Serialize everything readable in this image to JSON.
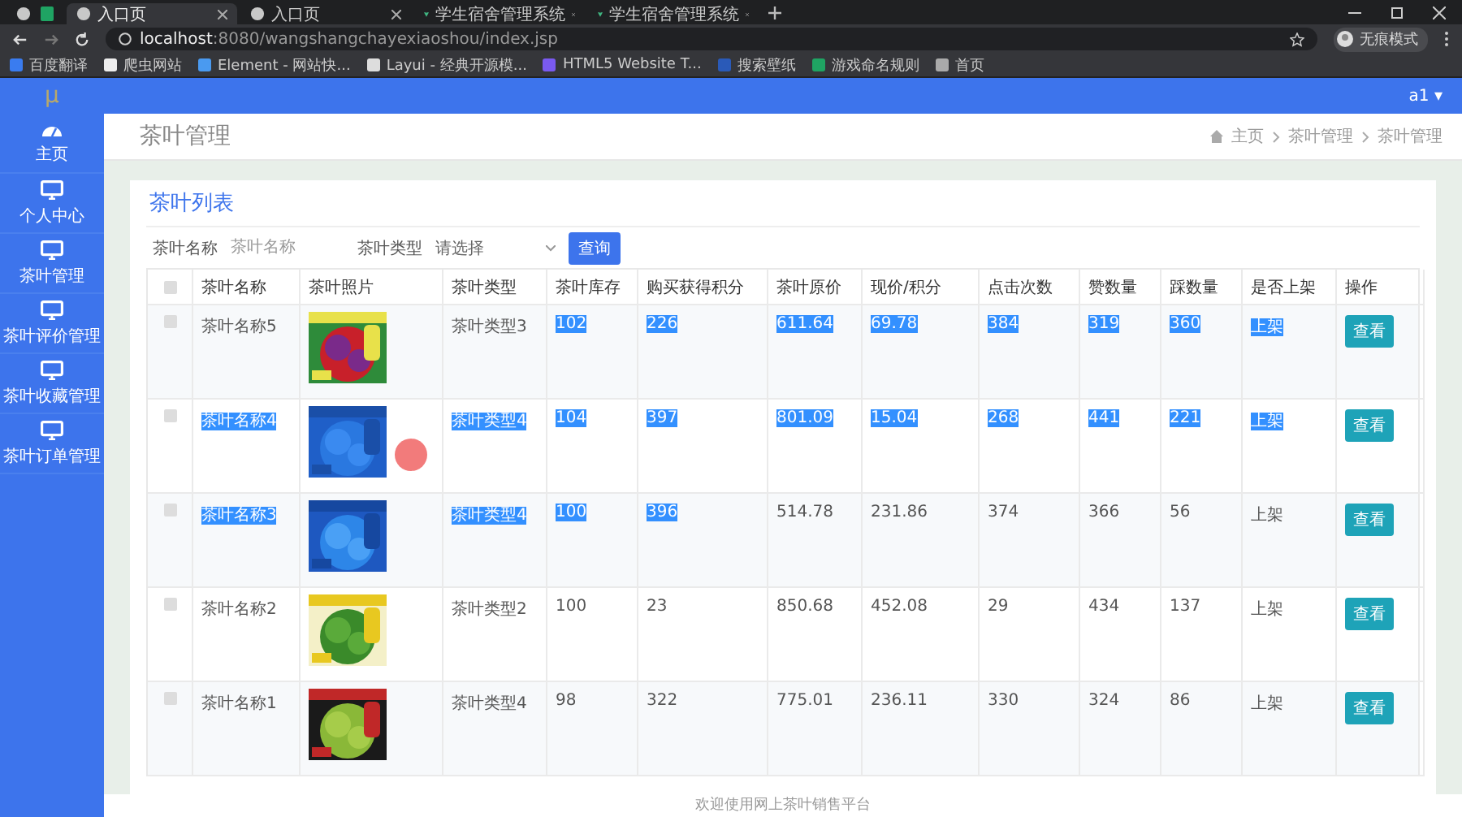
{
  "browser": {
    "tabs": [
      {
        "kind": "pinned",
        "selected": false
      },
      {
        "kind": "page",
        "label": "入口页",
        "selected": true
      },
      {
        "kind": "page",
        "label": "入口页",
        "selected": false
      },
      {
        "kind": "vue",
        "label": "学生宿舍管理系统",
        "selected": false
      },
      {
        "kind": "vue",
        "label": "学生宿舍管理系统",
        "selected": false
      }
    ],
    "url_host": "localhost",
    "url_rest": ":8080/wangshangchayexiaoshou/index.jsp",
    "profile": "无痕模式",
    "bookmarks": [
      "百度翻译",
      "爬虫网站",
      "Element - 网站快...",
      "Layui - 经典开源模...",
      "HTML5 Website T...",
      "搜索壁纸",
      "游戏命名规则",
      "首页"
    ]
  },
  "app": {
    "logo": "μ",
    "user": "a1 ▾",
    "sidebar": [
      {
        "kind": "dashboard",
        "label": "主页"
      },
      {
        "kind": "monitor",
        "label": "个人中心"
      },
      {
        "kind": "monitor",
        "label": "茶叶管理"
      },
      {
        "kind": "monitor",
        "label": "茶叶评价管理"
      },
      {
        "kind": "monitor",
        "label": "茶叶收藏管理"
      },
      {
        "kind": "monitor",
        "label": "茶叶订单管理"
      }
    ],
    "page_title": "茶叶管理",
    "breadcrumb": [
      "主页",
      "茶叶管理",
      "茶叶管理"
    ],
    "card_title": "茶叶列表",
    "search": {
      "name_label": "茶叶名称",
      "name_placeholder": "茶叶名称",
      "type_label": "茶叶类型",
      "type_placeholder": "请选择",
      "button": "查询"
    },
    "table": {
      "select_all_checked": false,
      "columns": [
        "茶叶名称",
        "茶叶照片",
        "茶叶类型",
        "茶叶库存",
        "购买获得积分",
        "茶叶原价",
        "现价/积分",
        "点击次数",
        "赞数量",
        "踩数量",
        "是否上架",
        "操作"
      ],
      "rows": [
        {
          "checked": false,
          "cells": [
            {
              "kind": "text",
              "text": "茶叶名称5",
              "highlighted": false
            },
            {
              "kind": "picture"
            },
            {
              "kind": "text",
              "text": "茶叶类型3",
              "highlighted": false
            },
            {
              "kind": "text",
              "text": "102",
              "highlighted": true
            },
            {
              "kind": "text",
              "text": "226",
              "highlighted": true
            },
            {
              "kind": "text",
              "text": "611.64",
              "highlighted": true
            },
            {
              "kind": "text",
              "text": "69.78",
              "highlighted": true
            },
            {
              "kind": "text",
              "text": "384",
              "highlighted": true
            },
            {
              "kind": "text",
              "text": "319",
              "highlighted": true
            },
            {
              "kind": "text",
              "text": "360",
              "highlighted": true
            },
            {
              "kind": "text",
              "text": "上架",
              "highlighted": true
            },
            {
              "kind": "button",
              "text": "查看"
            }
          ]
        },
        {
          "checked": false,
          "cells": [
            {
              "kind": "text",
              "text": "茶叶名称4",
              "highlighted": true
            },
            {
              "kind": "picture"
            },
            {
              "kind": "text",
              "text": "茶叶类型4",
              "highlighted": true
            },
            {
              "kind": "text",
              "text": "104",
              "highlighted": true
            },
            {
              "kind": "text",
              "text": "397",
              "highlighted": true
            },
            {
              "kind": "text",
              "text": "801.09",
              "highlighted": true
            },
            {
              "kind": "text",
              "text": "15.04",
              "highlighted": true
            },
            {
              "kind": "text",
              "text": "268",
              "highlighted": true
            },
            {
              "kind": "text",
              "text": "441",
              "highlighted": true
            },
            {
              "kind": "text",
              "text": "221",
              "highlighted": true
            },
            {
              "kind": "text",
              "text": "上架",
              "highlighted": true
            },
            {
              "kind": "button",
              "text": "查看"
            }
          ]
        },
        {
          "checked": false,
          "cells": [
            {
              "kind": "text",
              "text": "茶叶名称3",
              "highlighted": true
            },
            {
              "kind": "picture"
            },
            {
              "kind": "text",
              "text": "茶叶类型4",
              "highlighted": true
            },
            {
              "kind": "text",
              "text": "100",
              "highlighted": true
            },
            {
              "kind": "text",
              "text": "396",
              "highlighted": true
            },
            {
              "kind": "text",
              "text": "514.78",
              "highlighted": false
            },
            {
              "kind": "text",
              "text": "231.86",
              "highlighted": false
            },
            {
              "kind": "text",
              "text": "374",
              "highlighted": false
            },
            {
              "kind": "text",
              "text": "366",
              "highlighted": false
            },
            {
              "kind": "text",
              "text": "56",
              "highlighted": false
            },
            {
              "kind": "text",
              "text": "上架",
              "highlighted": false
            },
            {
              "kind": "button",
              "text": "查看"
            }
          ]
        },
        {
          "checked": false,
          "cells": [
            {
              "kind": "text",
              "text": "茶叶名称2",
              "highlighted": false
            },
            {
              "kind": "picture"
            },
            {
              "kind": "text",
              "text": "茶叶类型2",
              "highlighted": false
            },
            {
              "kind": "text",
              "text": "100",
              "highlighted": false
            },
            {
              "kind": "text",
              "text": "23",
              "highlighted": false
            },
            {
              "kind": "text",
              "text": "850.68",
              "highlighted": false
            },
            {
              "kind": "text",
              "text": "452.08",
              "highlighted": false
            },
            {
              "kind": "text",
              "text": "29",
              "highlighted": false
            },
            {
              "kind": "text",
              "text": "434",
              "highlighted": false
            },
            {
              "kind": "text",
              "text": "137",
              "highlighted": false
            },
            {
              "kind": "text",
              "text": "上架",
              "highlighted": false
            },
            {
              "kind": "button",
              "text": "查看"
            }
          ]
        },
        {
          "checked": false,
          "cells": [
            {
              "kind": "text",
              "text": "茶叶名称1",
              "highlighted": false
            },
            {
              "kind": "picture"
            },
            {
              "kind": "text",
              "text": "茶叶类型4",
              "highlighted": false
            },
            {
              "kind": "text",
              "text": "98",
              "highlighted": false
            },
            {
              "kind": "text",
              "text": "322",
              "highlighted": false
            },
            {
              "kind": "text",
              "text": "775.01",
              "highlighted": false
            },
            {
              "kind": "text",
              "text": "236.11",
              "highlighted": false
            },
            {
              "kind": "text",
              "text": "330",
              "highlighted": false
            },
            {
              "kind": "text",
              "text": "324",
              "highlighted": false
            },
            {
              "kind": "text",
              "text": "86",
              "highlighted": false
            },
            {
              "kind": "text",
              "text": "上架",
              "highlighted": false
            },
            {
              "kind": "button",
              "text": "查看"
            }
          ]
        }
      ]
    },
    "footer": "欢迎使用网上茶叶销售平台"
  }
}
